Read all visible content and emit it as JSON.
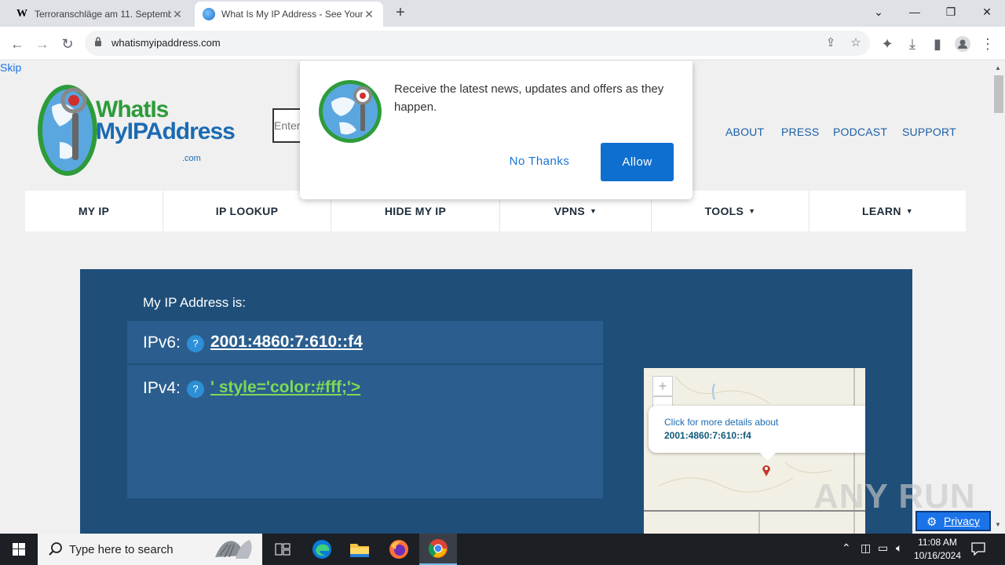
{
  "browser": {
    "tabs": [
      {
        "title": "Terroranschläge am 11. September",
        "favicon": "wikipedia-w-icon",
        "active": false
      },
      {
        "title": "What Is My IP Address - See Your",
        "favicon": "globe-icon",
        "active": true
      }
    ],
    "new_tab": "+",
    "url": "whatismyipaddress.com",
    "window_controls": {
      "dropdown": "⌄",
      "minimize": "—",
      "restore": "❐",
      "close": "✕"
    }
  },
  "page": {
    "skip_link": "Skip",
    "logo": {
      "line1": "WhatIs",
      "line2": "MyIPAddress",
      "suffix": ".com"
    },
    "search_placeholder": "Enter",
    "top_nav": [
      "ABOUT",
      "PRESS",
      "PODCAST",
      "SUPPORT"
    ],
    "main_nav": [
      {
        "label": "MY IP",
        "dropdown": false
      },
      {
        "label": "IP LOOKUP",
        "dropdown": false
      },
      {
        "label": "HIDE MY IP",
        "dropdown": false
      },
      {
        "label": "VPNS",
        "dropdown": true
      },
      {
        "label": "TOOLS",
        "dropdown": true
      },
      {
        "label": "LEARN",
        "dropdown": true
      }
    ],
    "hero": {
      "label": "My IP Address is:",
      "ipv6_key": "IPv6:",
      "ipv6_value": "2001:4860:7:610::f4",
      "ipv4_key": "IPv4:",
      "ipv4_value": "' style='color:#fff;'>",
      "help": "?"
    },
    "map": {
      "zoom_in": "+",
      "zoom_out": "−",
      "popup_line1": "Click for more details about",
      "popup_line2": "2001:4860:7:610::f4"
    },
    "notification": {
      "message": "Receive the latest news, updates and offers as they happen.",
      "decline": "No Thanks",
      "accept": "Allow"
    },
    "privacy_button": "Privacy",
    "watermark": "ANY RUN"
  },
  "taskbar": {
    "search_placeholder": "Type here to search",
    "time": "11:08 AM",
    "date": "10/16/2024"
  },
  "colors": {
    "hero_bg": "#1f4e79",
    "panel_bg": "#2b5e8e",
    "ipv4_green": "#7ed957",
    "allow_blue": "#0f6fcf",
    "nav_blue": "#1b5fa8"
  }
}
